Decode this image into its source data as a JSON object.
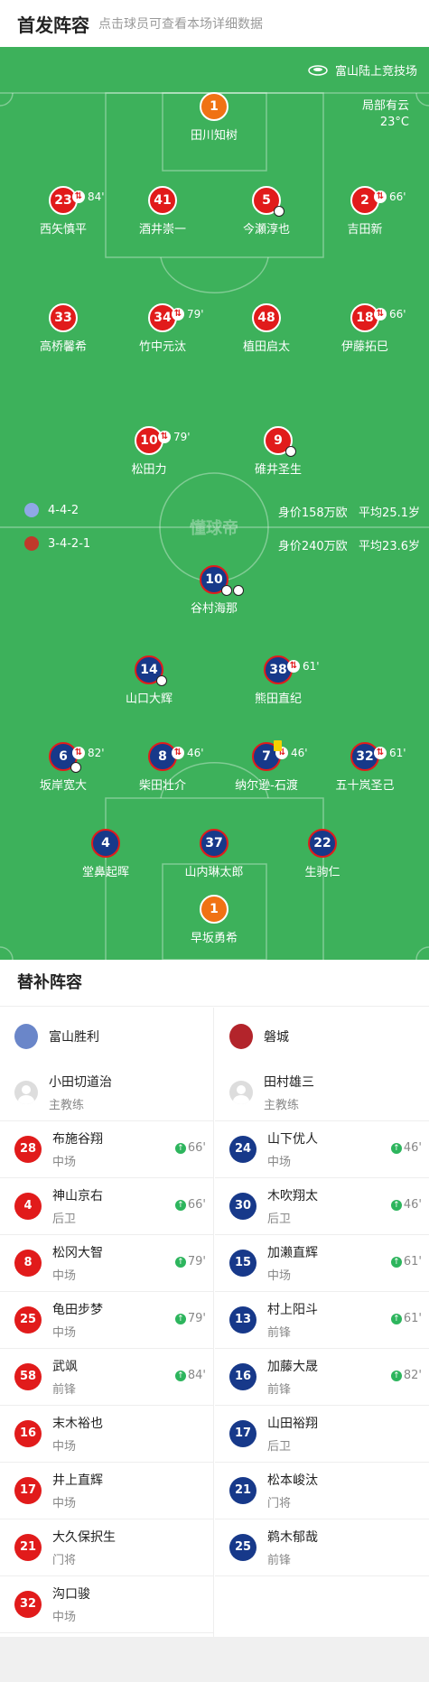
{
  "header": {
    "title": "首发阵容",
    "subtitle": "点击球员可查看本场详细数据"
  },
  "pitch": {
    "stadium": "富山陆上竞技场",
    "weather": "局部有云",
    "temperature": "23°C",
    "watermark": "懂球帝",
    "home_formation": "4-4-2",
    "home_value": "身价158万欧",
    "home_avg_age": "平均25.1岁",
    "away_formation": "3-4-2-1",
    "away_value": "身价240万欧",
    "away_avg_age": "平均23.6岁",
    "colors": {
      "grass": "#3db15b",
      "home": "#e11b1b",
      "away": "#17398a",
      "keeper": "#f07214"
    },
    "home_players": [
      {
        "num": "1",
        "name": "田川知树",
        "sub": ""
      },
      {
        "num": "23",
        "name": "西矢慎平",
        "sub": "84'"
      },
      {
        "num": "41",
        "name": "酒井崇一",
        "sub": ""
      },
      {
        "num": "5",
        "name": "今瀬淳也",
        "sub": ""
      },
      {
        "num": "2",
        "name": "吉田新",
        "sub": "66'"
      },
      {
        "num": "33",
        "name": "高桥馨希",
        "sub": ""
      },
      {
        "num": "34",
        "name": "竹中元汰",
        "sub": "79'"
      },
      {
        "num": "48",
        "name": "植田启太",
        "sub": ""
      },
      {
        "num": "18",
        "name": "伊藤拓巳",
        "sub": "66'"
      },
      {
        "num": "10",
        "name": "松田力",
        "sub": "79'"
      },
      {
        "num": "9",
        "name": "碓井圣生",
        "sub": ""
      }
    ],
    "away_players": [
      {
        "num": "10",
        "name": "谷村海那",
        "sub": ""
      },
      {
        "num": "14",
        "name": "山口大辉",
        "sub": ""
      },
      {
        "num": "38",
        "name": "熊田直纪",
        "sub": "61'"
      },
      {
        "num": "6",
        "name": "坂岸宽大",
        "sub": "82'"
      },
      {
        "num": "8",
        "name": "柴田壮介",
        "sub": "46'"
      },
      {
        "num": "7",
        "name": "纳尔逊-石渡",
        "sub": "46'"
      },
      {
        "num": "32",
        "name": "五十岚圣己",
        "sub": "61'"
      },
      {
        "num": "4",
        "name": "堂鼻起晖",
        "sub": ""
      },
      {
        "num": "37",
        "name": "山内琳太郎",
        "sub": ""
      },
      {
        "num": "22",
        "name": "生驹仁",
        "sub": ""
      },
      {
        "num": "1",
        "name": "早坂勇希",
        "sub": ""
      }
    ]
  },
  "bench": {
    "title": "替补阵容",
    "home": {
      "team": "富山胜利",
      "coach": {
        "name": "小田切道治",
        "role": "主教练"
      },
      "subs": [
        {
          "num": "28",
          "name": "布施谷翔",
          "pos": "中场",
          "min": "66'"
        },
        {
          "num": "4",
          "name": "神山京右",
          "pos": "后卫",
          "min": "66'"
        },
        {
          "num": "8",
          "name": "松冈大智",
          "pos": "中场",
          "min": "79'"
        },
        {
          "num": "25",
          "name": "龟田步梦",
          "pos": "中场",
          "min": "79'"
        },
        {
          "num": "58",
          "name": "武飒",
          "pos": "前锋",
          "min": "84'"
        },
        {
          "num": "16",
          "name": "末木裕也",
          "pos": "中场",
          "min": ""
        },
        {
          "num": "17",
          "name": "井上直辉",
          "pos": "中场",
          "min": ""
        },
        {
          "num": "21",
          "name": "大久保択生",
          "pos": "门将",
          "min": ""
        },
        {
          "num": "32",
          "name": "沟口骏",
          "pos": "中场",
          "min": ""
        }
      ]
    },
    "away": {
      "team": "磐城",
      "coach": {
        "name": "田村雄三",
        "role": "主教练"
      },
      "subs": [
        {
          "num": "24",
          "name": "山下优人",
          "pos": "中场",
          "min": "46'"
        },
        {
          "num": "30",
          "name": "木吹翔太",
          "pos": "后卫",
          "min": "46'"
        },
        {
          "num": "15",
          "name": "加濑直辉",
          "pos": "中场",
          "min": "61'"
        },
        {
          "num": "13",
          "name": "村上阳斗",
          "pos": "前锋",
          "min": "61'"
        },
        {
          "num": "16",
          "name": "加藤大晟",
          "pos": "前锋",
          "min": "82'"
        },
        {
          "num": "17",
          "name": "山田裕翔",
          "pos": "后卫",
          "min": ""
        },
        {
          "num": "21",
          "name": "松本峻汰",
          "pos": "门将",
          "min": ""
        },
        {
          "num": "25",
          "name": "鹈木郁哉",
          "pos": "前锋",
          "min": ""
        }
      ]
    }
  }
}
